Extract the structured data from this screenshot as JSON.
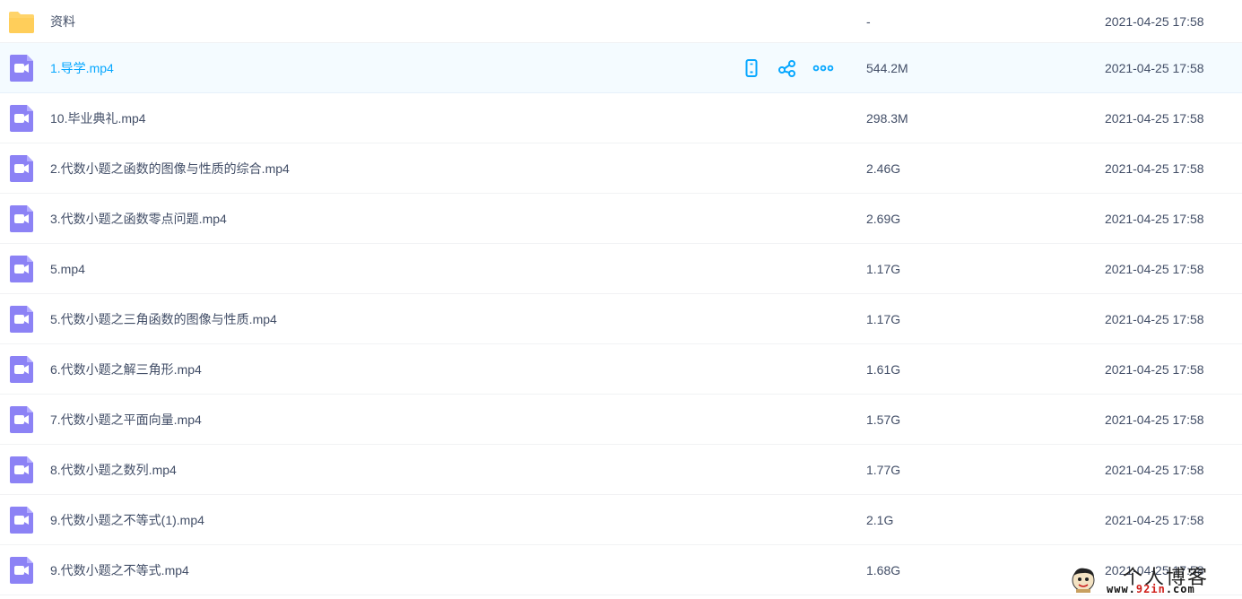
{
  "colors": {
    "accent": "#06a7ff",
    "video_icon": "#8c82f5",
    "folder_icon": "#ffd46a",
    "text": "#424e67",
    "hover_bg": "#f4fbff"
  },
  "files": [
    {
      "icon": "folder-icon",
      "name": "资料",
      "size": "-",
      "time": "2021-04-25 17:58"
    },
    {
      "icon": "video-file-icon",
      "name": "1.导学.mp4",
      "size": "544.2M",
      "time": "2021-04-25 17:58",
      "hovered": true
    },
    {
      "icon": "video-file-icon",
      "name": "10.毕业典礼.mp4",
      "size": "298.3M",
      "time": "2021-04-25 17:58"
    },
    {
      "icon": "video-file-icon",
      "name": "2.代数小题之函数的图像与性质的综合.mp4",
      "size": "2.46G",
      "time": "2021-04-25 17:58"
    },
    {
      "icon": "video-file-icon",
      "name": "3.代数小题之函数零点问题.mp4",
      "size": "2.69G",
      "time": "2021-04-25 17:58"
    },
    {
      "icon": "video-file-icon",
      "name": "5.mp4",
      "size": "1.17G",
      "time": "2021-04-25 17:58"
    },
    {
      "icon": "video-file-icon",
      "name": "5.代数小题之三角函数的图像与性质.mp4",
      "size": "1.17G",
      "time": "2021-04-25 17:58"
    },
    {
      "icon": "video-file-icon",
      "name": "6.代数小题之解三角形.mp4",
      "size": "1.61G",
      "time": "2021-04-25 17:58"
    },
    {
      "icon": "video-file-icon",
      "name": "7.代数小题之平面向量.mp4",
      "size": "1.57G",
      "time": "2021-04-25 17:58"
    },
    {
      "icon": "video-file-icon",
      "name": "8.代数小题之数列.mp4",
      "size": "1.77G",
      "time": "2021-04-25 17:58"
    },
    {
      "icon": "video-file-icon",
      "name": "9.代数小题之不等式(1).mp4",
      "size": "2.1G",
      "time": "2021-04-25 17:58"
    },
    {
      "icon": "video-file-icon",
      "name": "9.代数小题之不等式.mp4",
      "size": "1.68G",
      "time": "2021-04-25 17:58"
    }
  ],
  "row_actions": [
    {
      "icon": "phone-icon"
    },
    {
      "icon": "share-icon"
    },
    {
      "icon": "more-icon"
    }
  ],
  "watermark": {
    "title": "个人博客",
    "url_prefix": "www.",
    "url_highlight": "92in",
    "url_suffix": ".com"
  }
}
